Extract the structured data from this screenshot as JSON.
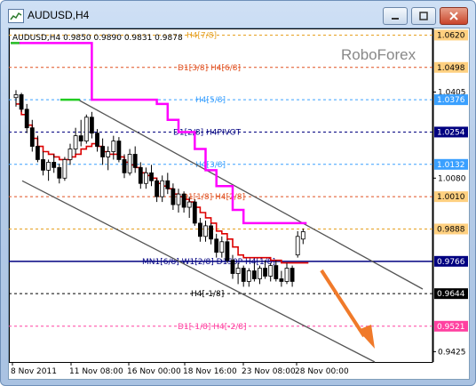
{
  "window": {
    "title": "AUDUSD,H4",
    "controls": [
      "minimize",
      "maximize",
      "close"
    ]
  },
  "chart": {
    "symbol_line": "AUDUSD,H4  0.9850 0.9890 0.9831 0.9878",
    "watermark": "RoboForex",
    "colors": {
      "up_line": "#ff00ff",
      "ma_line": "#dd0000",
      "channel": "#555555",
      "arrow": "#f07a2a",
      "pivot_line": "#000080",
      "current_price": "#ffd080"
    }
  },
  "chart_data": {
    "type": "candlestick",
    "price_axis": {
      "ylim": [
        0.9386,
        1.0645
      ],
      "tick_labels": [
        "1.0620",
        "1.0498",
        "1.0405",
        "1.0376",
        "1.0254",
        "1.0132",
        "1.0080",
        "1.0010",
        "0.9888",
        "0.9766",
        "0.9644",
        "0.9521",
        "0.9425"
      ],
      "highlighted": {
        "1.0620": "#ffd080",
        "1.0498": "#ffd080",
        "1.0376": "#3aa0ff",
        "1.0254": "#000080",
        "1.0132": "#3aa0ff",
        "1.0010": "#ffd080",
        "0.9888": "#ffd080",
        "0.9766": "#000080",
        "0.9644": "#000000",
        "0.9521": "#ff40a0"
      }
    },
    "time_axis": {
      "labels": [
        "8 Nov 2011",
        "11 Nov 08:00",
        "16 Nov 00:00",
        "18 Nov 16:00",
        "23 Nov 08:00",
        "28 Nov 00:00"
      ]
    },
    "levels": [
      {
        "label": "H4[7/8]",
        "price": 1.062,
        "color": "#e6a020",
        "style": "dashed"
      },
      {
        "label": "D1[3/8] H4[6/8]",
        "price": 1.0498,
        "color": "#e05020",
        "style": "dashed"
      },
      {
        "label": "H4[5/8]",
        "price": 1.0376,
        "color": "#3aa0ff",
        "style": "dashed"
      },
      {
        "label": "D1[2/8] H4PIVOT",
        "price": 1.0254,
        "color": "#000080",
        "style": "dashed"
      },
      {
        "label": "H4[3/8]",
        "price": 1.0132,
        "color": "#3aa0ff",
        "style": "dashed"
      },
      {
        "label": "D1[1/8] H4[2/8]",
        "price": 1.001,
        "color": "#e05020",
        "style": "dashed"
      },
      {
        "label": "",
        "price": 0.9888,
        "color": "#e6a020",
        "style": "dashed"
      },
      {
        "label": "MN1[6/8] W1[2/8] D1S0P H4[1/8]",
        "price": 0.9766,
        "color": "#000080",
        "style": "solid"
      },
      {
        "label": "H4[-1/8]",
        "price": 0.9644,
        "color": "#000000",
        "style": "dashed"
      },
      {
        "label": "D1[-1/8] H4[-2/8]",
        "price": 0.9521,
        "color": "#ff40a0",
        "style": "dashed"
      }
    ],
    "current_price": 0.9878,
    "candles": [
      [
        1.0384,
        1.0412,
        1.035,
        1.0395
      ],
      [
        1.0395,
        1.0402,
        1.033,
        1.034
      ],
      [
        1.034,
        1.036,
        1.025,
        1.027
      ],
      [
        1.027,
        1.03,
        1.018,
        1.02
      ],
      [
        1.02,
        1.024,
        1.014,
        1.015
      ],
      [
        1.015,
        1.018,
        1.009,
        1.011
      ],
      [
        1.011,
        1.015,
        1.007,
        1.014
      ],
      [
        1.014,
        1.017,
        1.01,
        1.012
      ],
      [
        1.012,
        1.0135,
        1.006,
        1.008
      ],
      [
        1.008,
        1.016,
        1.007,
        1.015
      ],
      [
        1.015,
        1.021,
        1.013,
        1.019
      ],
      [
        1.019,
        1.027,
        1.017,
        1.024
      ],
      [
        1.024,
        1.03,
        1.02,
        1.022
      ],
      [
        1.022,
        1.032,
        1.021,
        1.031
      ],
      [
        1.031,
        1.033,
        1.023,
        1.025
      ],
      [
        1.025,
        1.0265,
        1.018,
        1.02
      ],
      [
        1.02,
        1.023,
        1.013,
        1.016
      ],
      [
        1.016,
        1.02,
        1.011,
        1.018
      ],
      [
        1.018,
        1.024,
        1.015,
        1.022
      ],
      [
        1.022,
        1.0235,
        1.014,
        1.015
      ],
      [
        1.015,
        1.017,
        1.008,
        1.01
      ],
      [
        1.01,
        1.019,
        1.009,
        1.017
      ],
      [
        1.017,
        1.02,
        1.01,
        1.012
      ],
      [
        1.012,
        1.014,
        1.004,
        1.006
      ],
      [
        1.006,
        1.012,
        1.004,
        1.01
      ],
      [
        1.01,
        1.013,
        1.005,
        1.007
      ],
      [
        1.007,
        1.008,
        0.999,
        1.001
      ],
      [
        1.001,
        1.009,
        0.999,
        1.007
      ],
      [
        1.007,
        1.01,
        1.002,
        1.004
      ],
      [
        1.004,
        1.006,
        0.996,
        0.998
      ],
      [
        0.998,
        1.004,
        0.995,
        1.002
      ],
      [
        1.002,
        1.003,
        0.995,
        0.997
      ],
      [
        0.997,
        1.001,
        0.993,
        0.999
      ],
      [
        0.999,
        1.0,
        0.99,
        0.991
      ],
      [
        0.991,
        0.993,
        0.984,
        0.986
      ],
      [
        0.986,
        0.992,
        0.984,
        0.99
      ],
      [
        0.99,
        0.991,
        0.983,
        0.985
      ],
      [
        0.985,
        0.987,
        0.978,
        0.98
      ],
      [
        0.98,
        0.986,
        0.978,
        0.984
      ],
      [
        0.984,
        0.985,
        0.976,
        0.977
      ],
      [
        0.977,
        0.979,
        0.97,
        0.972
      ],
      [
        0.972,
        0.976,
        0.968,
        0.974
      ],
      [
        0.974,
        0.975,
        0.967,
        0.969
      ],
      [
        0.969,
        0.974,
        0.967,
        0.973
      ],
      [
        0.973,
        0.976,
        0.969,
        0.97
      ],
      [
        0.97,
        0.975,
        0.968,
        0.974
      ],
      [
        0.974,
        0.977,
        0.97,
        0.971
      ],
      [
        0.971,
        0.976,
        0.969,
        0.975
      ],
      [
        0.975,
        0.977,
        0.969,
        0.97
      ],
      [
        0.97,
        0.973,
        0.967,
        0.969
      ],
      [
        0.969,
        0.976,
        0.968,
        0.974
      ],
      [
        0.974,
        0.975,
        0.967,
        0.969
      ],
      [
        0.979,
        0.988,
        0.978,
        0.986
      ],
      [
        0.985,
        0.989,
        0.9831,
        0.9878
      ]
    ],
    "ma_line": [
      1.036,
      1.032,
      1.028,
      1.023,
      1.02,
      1.018,
      1.017,
      1.016,
      1.015,
      1.015,
      1.016,
      1.017,
      1.019,
      1.02,
      1.021,
      1.02,
      1.018,
      1.017,
      1.017,
      1.016,
      1.014,
      1.013,
      1.012,
      1.01,
      1.009,
      1.008,
      1.006,
      1.005,
      1.004,
      1.002,
      1.001,
      1.0,
      0.999,
      0.997,
      0.995,
      0.993,
      0.991,
      0.988,
      0.987,
      0.985,
      0.982,
      0.979,
      0.978,
      0.978,
      0.978,
      0.978,
      0.978,
      0.977,
      0.977,
      0.976,
      0.976,
      0.976,
      0.976,
      0.976
    ],
    "upper_stepline": [
      1.059,
      1.059,
      1.059,
      1.059,
      1.059,
      1.059,
      1.059,
      1.059,
      1.059,
      1.059,
      1.059,
      1.059,
      1.059,
      1.059,
      1.0376,
      1.0376,
      1.0376,
      1.0376,
      1.0376,
      1.0376,
      1.0376,
      1.0376,
      1.0376,
      1.0376,
      1.0376,
      1.0376,
      1.036,
      1.036,
      1.03,
      1.03,
      1.0254,
      1.0254,
      1.0254,
      1.019,
      1.019,
      1.011,
      1.011,
      1.005,
      1.005,
      1.005,
      0.996,
      0.996,
      0.991,
      0.991,
      0.991,
      0.991,
      0.991,
      0.991,
      0.991,
      0.991,
      0.991,
      0.991,
      0.991,
      0.991
    ],
    "channel_upper": [
      [
        0,
        1.0376
      ],
      [
        54,
        0.964
      ]
    ],
    "channel_lower": [
      [
        0,
        1.007
      ],
      [
        54,
        0.942
      ]
    ]
  }
}
